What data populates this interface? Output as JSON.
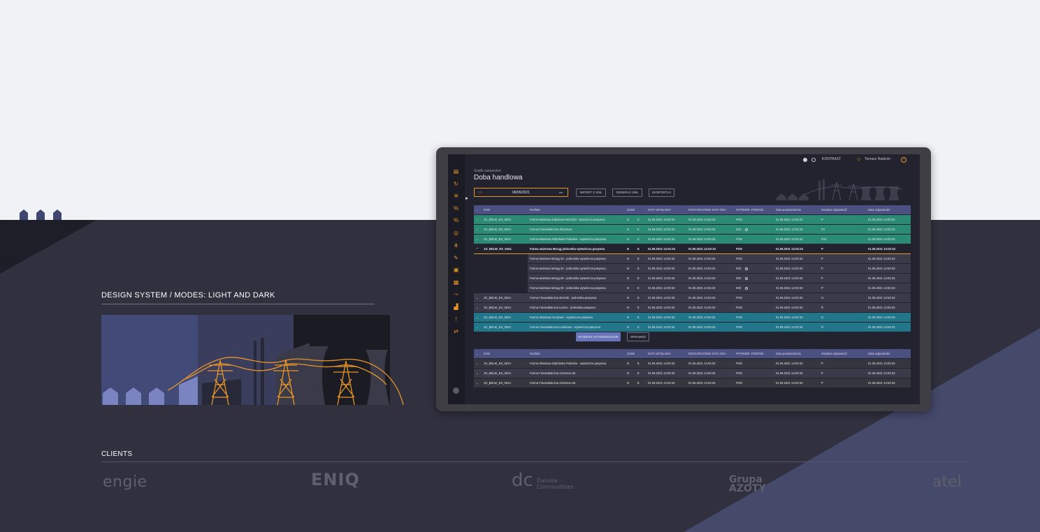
{
  "design_section": {
    "title": "DESIGN SYSTEM / MODES: LIGHT AND DARK"
  },
  "clients": {
    "title": "CLIENTS",
    "logos": [
      "ENGIE",
      "ENIQ",
      "dc",
      "Grupa Azoty",
      "atel"
    ],
    "logo_texts": {
      "engie": "engie",
      "eniq": "ENIQ",
      "dc": "dc",
      "dc_name": "Danske Commodities",
      "azoty_1": "Grupa",
      "azoty_2": "AZOTY",
      "atel": "atel"
    }
  },
  "colors": {
    "accent": "#e8952a",
    "dark_bg": "#30303e",
    "light_bg": "#f1f2f6",
    "header": "#4a5080",
    "green_row": "#2a8b72",
    "teal_row": "#21768a"
  },
  "app": {
    "topbar": {
      "kontrast": "KONTRAST",
      "user": "Tomasz Radecki"
    },
    "breadcrumb": "Grafik zastrzeżeń",
    "title": "Doba handlowa",
    "date_value": "06/06/2021",
    "buttons": {
      "import": "IMPORT Z XML",
      "generate": "GENERUJ XML",
      "export": "EKSPORTUJ",
      "select_confirmed": "WYBIERZ ZATWIERDZONE",
      "check": "SPRAWDŹ"
    },
    "table_headers": [
      "KOD",
      "NAZWA",
      "ZUSE",
      "DATA WYSŁANIA",
      "DOSTARCZONO DATA ODA",
      "POTWIER. POD/IOD",
      "Data potwierdzenia",
      "Ostatnia odpowiedź",
      "Data odpowiedzi"
    ],
    "rows": [
      {
        "style": "green",
        "chev": "⌄",
        "kod": "JG_BELW_ES_0044",
        "nazwa": "Farma Wiatrowa Kąkolewo-Wschód - wytwórcza pasywna",
        "z1": "N",
        "z2": "E",
        "sent": "01.06.2021 14:03:33",
        "delivered": "01.06.2021 14:03:33",
        "pot": "POD",
        "dot": false,
        "conf": "01.06.2021 14:03:33",
        "last": "P",
        "last_color": "p",
        "resp": "01.06.2021 14:03:33"
      },
      {
        "style": "green",
        "chev": "⌄",
        "kod": "JG_BELW_ES_0044",
        "nazwa": "Farma Fotowoltaiczna Skórzewo",
        "z1": "N",
        "z2": "E",
        "sent": "01.06.2021 14:03:33",
        "delivered": "01.06.2021 14:03:33",
        "pot": "IOD",
        "dot": true,
        "conf": "01.06.2021 14:03:33",
        "last": "P2",
        "last_color": "p",
        "resp": "01.06.2021 14:03:33"
      },
      {
        "style": "green",
        "chev": "⌄",
        "kod": "JG_BELW_ES_0044",
        "nazwa": "Farma Wiatrowa Dąbrówka Południe - wytwórcza pasywna",
        "z1": "N",
        "z2": "E",
        "sent": "01.06.2021 14:03:33",
        "delivered": "01.06.2021 14:03:33",
        "pot": "POD",
        "dot": false,
        "conf": "01.06.2021 14:03:33",
        "last": "P22",
        "last_color": "p",
        "resp": "01.06.2021 14:03:33"
      },
      {
        "style": "bold",
        "chev": "⌃",
        "kod": "JG_BELW_ES_0044",
        "nazwa": "Farma wiatrowa Morąg jednostka wytwórcza pasywna",
        "z1": "N",
        "z2": "E",
        "sent": "01.06.2021 14:03:33",
        "delivered": "01.06.2021 14:03:33",
        "pot": "POD",
        "dot": false,
        "conf": "01.06.2021 14:03:33",
        "last": "P",
        "last_color": "p",
        "resp": "01.06.2021 14:03:33"
      },
      {
        "style": "child",
        "chev": "",
        "kod": "",
        "nazwa": "Farma wiatrowa Morąg 03 - jednostka wytwórcza pasywna",
        "z1": "N",
        "z2": "E",
        "sent": "01.06.2021 14:03:33",
        "delivered": "01.06.2021 14:03:33",
        "pot": "POD",
        "dot": false,
        "conf": "01.06.2021 14:03:33",
        "last": "P",
        "last_color": "p",
        "resp": "01.06.2021 14:03:33"
      },
      {
        "style": "child",
        "chev": "",
        "kod": "",
        "nazwa": "Farma wiatrowa Morąg 04 - jednostka wytwórcza pasywna",
        "z1": "N",
        "z2": "E",
        "sent": "01.06.2021 14:03:33",
        "delivered": "01.06.2021 14:03:33",
        "pot": "IOD",
        "dot": true,
        "conf": "01.06.2021 14:03:33",
        "last": "P",
        "last_color": "p",
        "resp": "01.06.2021 14:03:33"
      },
      {
        "style": "child",
        "chev": "",
        "kod": "",
        "nazwa": "Farma wiatrowa Morąg 05 - jednostka wytwórcza pasywna",
        "z1": "N",
        "z2": "E",
        "sent": "01.06.2021 14:03:33",
        "delivered": "01.06.2021 14:03:33",
        "pot": "IOD",
        "dot": true,
        "conf": "01.06.2021 14:03:33",
        "last": "P",
        "last_color": "p",
        "resp": "01.06.2021 14:03:33"
      },
      {
        "style": "child",
        "chev": "",
        "kod": "",
        "nazwa": "Farma wiatrowa Morąg 06 - jednostka wytwórcza pasywna",
        "z1": "N",
        "z2": "E",
        "sent": "01.06.2021 14:03:33",
        "delivered": "01.06.2021 14:03:33",
        "pot": "IOD",
        "dot": true,
        "conf": "01.06.2021 14:03:33",
        "last": "P",
        "last_color": "p",
        "resp": "01.06.2021 14:03:33"
      },
      {
        "style": "dark",
        "chev": "⌄",
        "kod": "JG_BELW_ES_0044",
        "nazwa": "Farma Fotowoltaiczna Brzeski - jednostka pasywna",
        "z1": "N",
        "z2": "E",
        "sent": "01.06.2021 14:03:33",
        "delivered": "01.06.2021 14:03:33",
        "pot": "POD",
        "dot": false,
        "conf": "01.06.2021 14:03:33",
        "last": "O",
        "last_color": "r",
        "resp": "01.06.2021 14:03:33"
      },
      {
        "style": "dark",
        "chev": "⌄",
        "kod": "JG_BELW_ES_0044",
        "nazwa": "Farma Fotowoltaiczna Łozice - jednostka pasywna",
        "z1": "N",
        "z2": "E",
        "sent": "01.06.2021 14:03:33",
        "delivered": "01.06.2021 14:03:33",
        "pot": "POD",
        "dot": false,
        "conf": "01.06.2021 14:03:33",
        "last": "R",
        "last_color": "r",
        "resp": "01.06.2021 14:03:33"
      },
      {
        "style": "teal",
        "chev": "⌄",
        "kod": "JG_BELW_ES_0044",
        "nazwa": "Farma Wiatrowa Grodowo - wytwórcza pasywna",
        "z1": "N",
        "z2": "E",
        "sent": "01.06.2021 14:03:33",
        "delivered": "01.06.2021 14:03:33",
        "pot": "POD",
        "dot": false,
        "conf": "01.06.2021 14:03:33",
        "last": "O",
        "last_color": "r",
        "resp": "01.06.2021 14:03:33"
      },
      {
        "style": "teal",
        "chev": "⌄",
        "kod": "JG_BELW_ES_0044",
        "nazwa": "Farma Fotowoltaiczna Leśniewo - wytwórcza pasywna",
        "z1": "N",
        "z2": "E",
        "sent": "01.06.2021 14:03:33",
        "delivered": "01.06.2021 14:03:33",
        "pot": "POD",
        "dot": false,
        "conf": "01.06.2021 14:03:33",
        "last": "R",
        "last_color": "r",
        "resp": "01.06.2021 14:03:33"
      }
    ],
    "rows2": [
      {
        "style": "grey",
        "chev": "⌄",
        "kod": "JG_BELW_ES_0044",
        "nazwa": "Farma Wiatrowa Dąbrówka Południe - wytwórcza pasywna",
        "z1": "N",
        "z2": "E",
        "sent": "01.06.2021 14:03:33",
        "delivered": "01.06.2021 14:03:33",
        "pot": "POD",
        "dot": false,
        "conf": "01.06.2021 14:03:33",
        "last": "P",
        "last_color": "p",
        "resp": "01.06.2021 14:03:33"
      },
      {
        "style": "dark",
        "chev": "⌄",
        "kod": "JG_BELW_ES_0044",
        "nazwa": "Farma Fotowoltaiczna Cietrzew AB",
        "z1": "N",
        "z2": "E",
        "sent": "01.06.2021 14:03:33",
        "delivered": "01.06.2021 14:03:33",
        "pot": "POD",
        "dot": false,
        "conf": "01.06.2021 14:03:33",
        "last": "P",
        "last_color": "p",
        "resp": "01.06.2021 14:03:33"
      },
      {
        "style": "grey",
        "chev": "⌄",
        "kod": "JG_BELW_ES_0044",
        "nazwa": "Farma Fotowoltaiczna Cietrzew AB",
        "z1": "N",
        "z2": "E",
        "sent": "01.06.2021 14:03:33",
        "delivered": "01.06.2021 14:03:33",
        "pot": "POD",
        "dot": false,
        "conf": "01.06.2021 14:03:33",
        "last": "P",
        "last_color": "p",
        "resp": "01.06.2021 14:03:33"
      }
    ]
  }
}
